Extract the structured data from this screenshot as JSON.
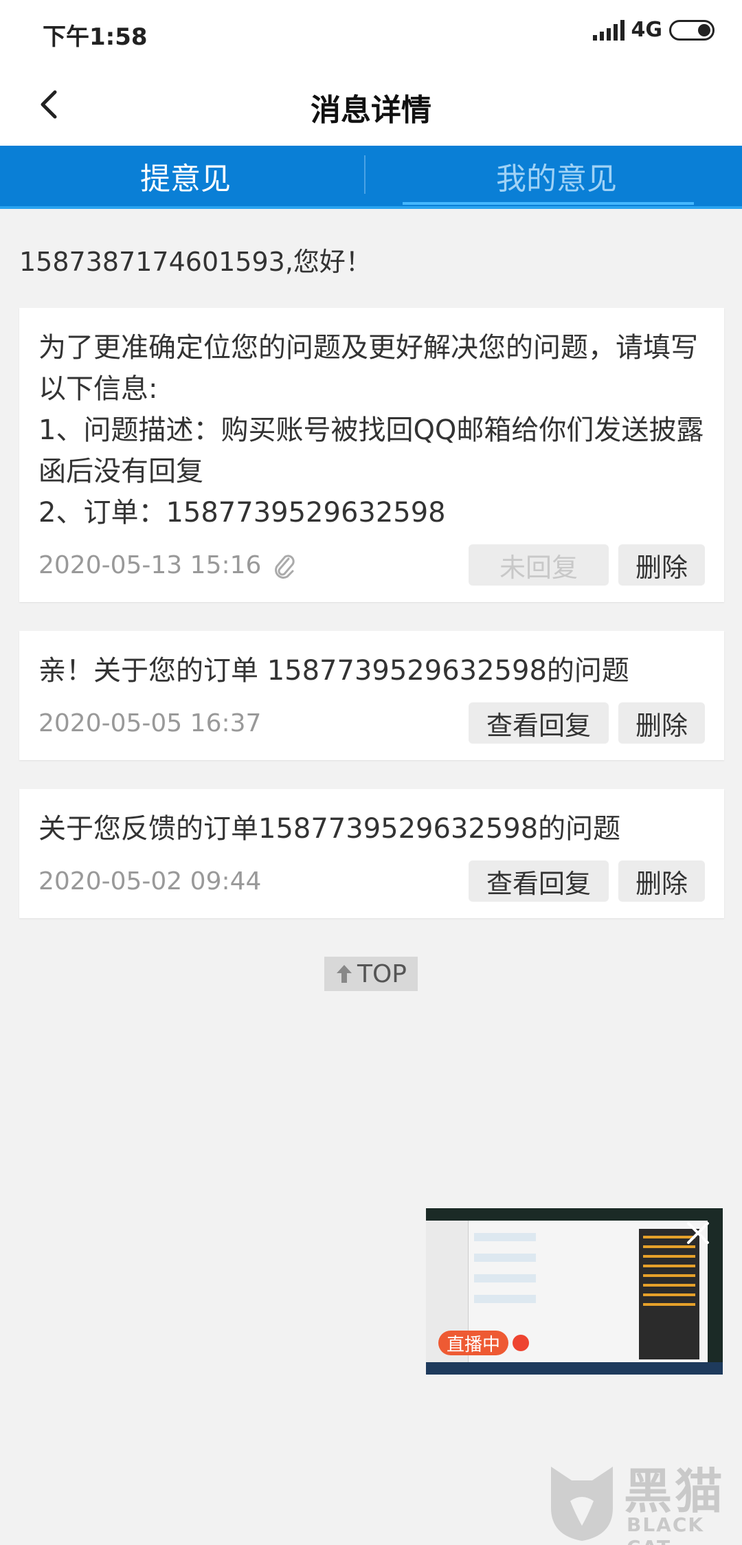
{
  "status_bar": {
    "time": "下午1:58",
    "network": "4G"
  },
  "nav": {
    "title": "消息详情"
  },
  "tabs": [
    {
      "label": "提意见",
      "active": false
    },
    {
      "label": "我的意见",
      "active": true
    }
  ],
  "greeting": "1587387174601593,您好！",
  "messages": [
    {
      "text": "为了更准确定位您的问题及更好解决您的问题，请填写以下信息:\n1、问题描述：购买账号被找回QQ邮箱给你们发送披露函后没有回复\n2、订单：1587739529632598",
      "date": "2020-05-13 15:16",
      "status_label": "未回复",
      "delete_label": "删除",
      "has_attachment": true
    },
    {
      "text": "亲！关于您的订单 1587739529632598的问题",
      "date": "2020-05-05 16:37",
      "status_label": "查看回复",
      "delete_label": "删除"
    },
    {
      "text": "关于您反馈的订单1587739529632598的问题",
      "date": "2020-05-02 09:44",
      "status_label": "查看回复",
      "delete_label": "删除"
    }
  ],
  "top_button": {
    "label": "TOP"
  },
  "live_preview": {
    "badge": "直播中"
  },
  "watermark": {
    "cn": "黑猫",
    "en": "BLACK CAT"
  },
  "colors": {
    "tab_bar": "#0a7fd6",
    "live_badge": "#ee5a33",
    "background": "#f2f2f2"
  }
}
